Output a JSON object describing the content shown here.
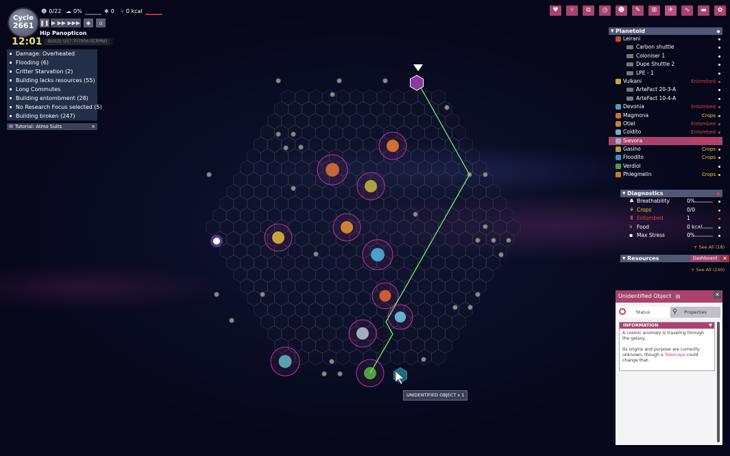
{
  "hud": {
    "cycle_label": "Cycle",
    "cycle_number": "2661",
    "clock": "12:01",
    "duplicants": "0/22",
    "stress": "0%",
    "critters": "0",
    "food": "0 kcal",
    "colony_name": "Hip Panopticon",
    "build": "BUILD: U57-707956-SCRPNO"
  },
  "speed_controls": [
    "pause",
    "speed-1",
    "speed-2",
    "speed-3",
    "red-alert",
    "print-pod"
  ],
  "status_items": [
    "Damage: Overheated",
    "Flooding (6)",
    "Critter Starvation (2)",
    "Building lacks resources (55)",
    "Long Commutes",
    "Building entombment (28)",
    "No Research Focus selected (5)",
    "Building broken (247)"
  ],
  "tutorial": {
    "label": "Tutorial: Atmo Suits",
    "close": "×"
  },
  "toolbar_icons": [
    "vitals-icon",
    "consumables-icon",
    "schedule-icon",
    "priorities-icon",
    "skills-icon",
    "research-icon",
    "codex-icon",
    "starmap-icon",
    "report-icon",
    "database-icon",
    "settings-icon"
  ],
  "planetoid": {
    "title": "Planetoid",
    "rows": [
      {
        "name": "Leirani",
        "status": "",
        "dot": "#ffffff",
        "type": "planet",
        "color": "#c54a3a"
      },
      {
        "name": "Carbon shuttle",
        "status": "",
        "dot": "#ffffff",
        "type": "rocket"
      },
      {
        "name": "Coloniser 1",
        "status": "",
        "dot": "#ffffff",
        "type": "rocket"
      },
      {
        "name": "Dupe Shuttle 2",
        "status": "",
        "dot": "#ffffff",
        "type": "rocket"
      },
      {
        "name": "LPE - 1",
        "status": "",
        "dot": "#ffffff",
        "type": "rocket"
      },
      {
        "name": "Vulkani",
        "status": "Entombed",
        "dot": "#e04040",
        "type": "planet",
        "color": "#c7a53a"
      },
      {
        "name": "ArteFact 20-3-A",
        "status": "",
        "dot": "#ffffff",
        "type": "rocket"
      },
      {
        "name": "ArteFact 10-4-A",
        "status": "",
        "dot": "#ffffff",
        "type": "rocket"
      },
      {
        "name": "Devonia",
        "status": "Entombed",
        "dot": "#e04040",
        "type": "planet",
        "color": "#4aa0c5"
      },
      {
        "name": "Magmona",
        "status": "Crops",
        "dot": "#f0d040",
        "type": "planet",
        "color": "#d07030"
      },
      {
        "name": "Otiel",
        "status": "Entombed",
        "dot": "#e04040",
        "type": "planet",
        "color": "#d0803a"
      },
      {
        "name": "Coldito",
        "status": "Entombed",
        "dot": "#e04040",
        "type": "planet",
        "color": "#6ab0d0"
      },
      {
        "name": "Sievora",
        "status": "Entombed",
        "dot": "#e04040",
        "type": "planet",
        "color": "#a0b0c0",
        "selected": true
      },
      {
        "name": "Gasino",
        "status": "Crops",
        "dot": "#f0d040",
        "type": "planet",
        "color": "#b0a040"
      },
      {
        "name": "Floodito",
        "status": "Crops",
        "dot": "#f0d040",
        "type": "planet",
        "color": "#3a90c0"
      },
      {
        "name": "Verdiol",
        "status": "",
        "dot": "#ffffff",
        "type": "planet",
        "color": "#50a040"
      },
      {
        "name": "Phlegmelin",
        "status": "Crops",
        "dot": "#f0d040",
        "type": "planet",
        "color": "#c08030"
      }
    ]
  },
  "diagnostics": {
    "title": "Diagnostics",
    "rows": [
      {
        "label": "Breathability",
        "value": "0%",
        "icon": "lungs-icon",
        "label_color": "#ffffff",
        "dot": "#ffffff",
        "bar": true
      },
      {
        "label": "Crops",
        "value": "0/0",
        "icon": "crops-icon",
        "label_color": "#f0d040",
        "dot": "#f0d040",
        "bar": false
      },
      {
        "label": "Entombed",
        "value": "1",
        "icon": "entombed-icon",
        "label_color": "#e04040",
        "dot": "#e04040",
        "bar": false
      },
      {
        "label": "Food",
        "value": "0 kcal",
        "icon": "food-icon",
        "label_color": "#ffffff",
        "dot": "#ffffff",
        "bar": true
      },
      {
        "label": "Max Stress",
        "value": "0%",
        "icon": "stress-icon",
        "label_color": "#ffffff",
        "dot": "#ffffff",
        "bar": true
      }
    ],
    "see_all": "+ See All (18)"
  },
  "resources": {
    "title": "Resources",
    "dashboard": "Dashboard",
    "close": "✕",
    "see_all": "+ See All (240)"
  },
  "detail": {
    "title": "Unidentified Object",
    "tab_status": "Status",
    "tab_properties": "Properties",
    "info_header": "INFORMATION",
    "text_1": "A cosmic anomaly is traveling through the galaxy.",
    "text_2a": "Its origins and purpose are currently unknown, though a ",
    "text_2_link": "Telescope",
    "text_2b": " could change that."
  },
  "tooltip": "UNIDENTIFIED OBJECT x 1",
  "colors": {
    "accent": "#a9436e",
    "route": "#6ef06a",
    "warning": "#e04040",
    "crops": "#f0d040"
  }
}
